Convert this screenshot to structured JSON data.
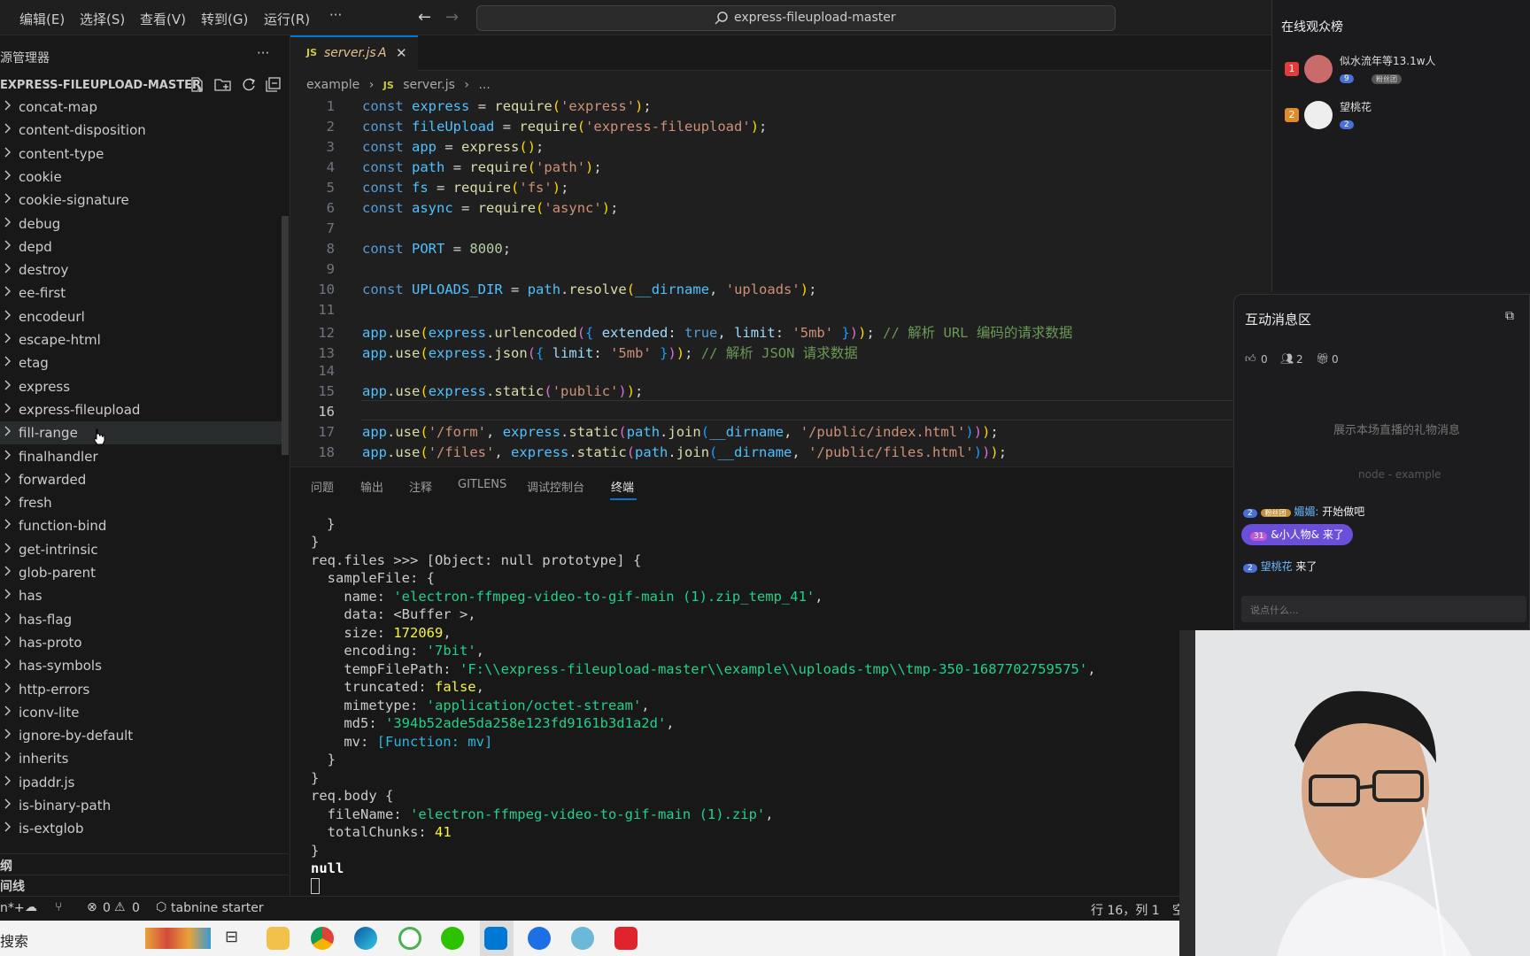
{
  "menu": [
    "编辑(E)",
    "选择(S)",
    "查看(V)",
    "转到(G)",
    "运行(R)",
    "···"
  ],
  "search_text": "express-fileupload-master",
  "explorer": {
    "title": "源管理器",
    "more": "···",
    "root": "EXPRESS-FILEUPLOAD-MASTER",
    "items": [
      "concat-map",
      "content-disposition",
      "content-type",
      "cookie",
      "cookie-signature",
      "debug",
      "depd",
      "destroy",
      "ee-first",
      "encodeurl",
      "escape-html",
      "etag",
      "express",
      "express-fileupload",
      "fill-range",
      "finalhandler",
      "forwarded",
      "fresh",
      "function-bind",
      "get-intrinsic",
      "glob-parent",
      "has",
      "has-flag",
      "has-proto",
      "has-symbols",
      "http-errors",
      "iconv-lite",
      "ignore-by-default",
      "inherits",
      "ipaddr.js",
      "is-binary-path",
      "is-extglob"
    ],
    "outline_label": "纲",
    "timeline_label": "间线"
  },
  "tab": {
    "icon": "JS",
    "name": "server.js",
    "badge": "A",
    "close": "✕"
  },
  "breadcrumb": {
    "folder": "example",
    "icon": "JS",
    "file": "server.js",
    "more": "..."
  },
  "code_lines": [
    "1",
    "2",
    "3",
    "4",
    "5",
    "6",
    "7",
    "8",
    "9",
    "10",
    "11",
    "12",
    "13",
    "14",
    "15",
    "16",
    "17",
    "18"
  ],
  "code_comments": {
    "line12": "// 解析 URL 编码的请求数据",
    "line13": "// 解析 JSON 请求数据"
  },
  "panel_tabs": [
    "问题",
    "输出",
    "注释",
    "GITLENS",
    "调试控制台",
    "终端"
  ],
  "terminal": {
    "files_name": "'electron-ffmpeg-video-to-gif-main (1).zip_temp_41'",
    "size": "172069",
    "encoding": "'7bit'",
    "temp_path": "'F:\\\\express-fileupload-master\\\\example\\\\uploads-tmp\\\\tmp-350-1687702759575'",
    "truncated": "false",
    "mimetype": "'application/octet-stream'",
    "md5": "'394b52ade5da258e123fd9161b3d1a2d'",
    "mv": "[Function: mv]",
    "body_file": "'electron-ffmpeg-video-to-gif-main (1).zip'",
    "chunks": "41",
    "last": "null"
  },
  "status": {
    "left": "n*+",
    "errors": "0",
    "warnings": "0",
    "tabnine": "tabnine starter",
    "position": "行 16，列 1",
    "trailing": "空"
  },
  "taskbar": {
    "search": "搜索"
  },
  "viewers": {
    "title": "在线观众榜",
    "list": [
      {
        "rank": "1",
        "name": "似水流年等13.1w人",
        "level": "9",
        "badge": "粉丝团"
      },
      {
        "rank": "2",
        "name": "望桃花",
        "level": "2"
      }
    ]
  },
  "chat": {
    "title": "互动消息区",
    "likes": "0",
    "users": "2",
    "gifts": "0",
    "gift_placeholder": "展示本场直播的礼物消息",
    "terminal_ghost": "node - example",
    "messages": [
      {
        "level": "2",
        "badge": "粉丝团",
        "name": "媚媚:",
        "text": "开始做吧"
      },
      {
        "level": "31",
        "name": "&小人物&",
        "text": "来了"
      },
      {
        "level": "2",
        "name": "望桃花",
        "text": "来了"
      }
    ],
    "input_placeholder": "说点什么..."
  },
  "colors": {
    "accent": "#0078d4",
    "editor_bg": "#1f1f1f",
    "sidebar_bg": "#181818"
  }
}
